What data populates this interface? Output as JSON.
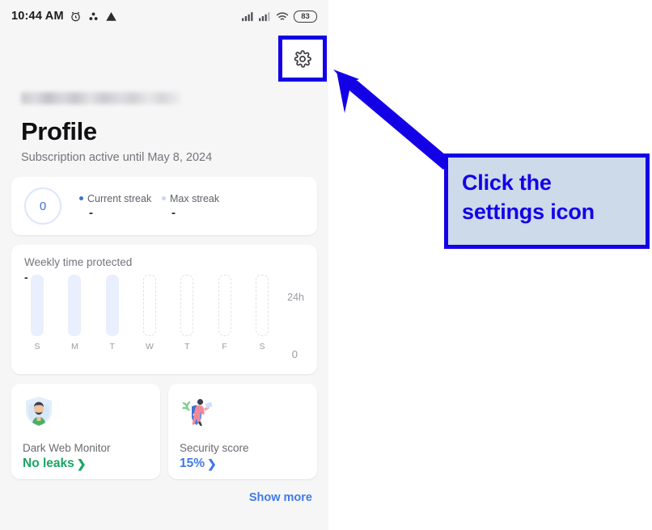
{
  "statusbar": {
    "time": "10:44 AM",
    "icons": [
      "alarm-clock-icon",
      "dots-cluster-icon",
      "warning-triangle-icon"
    ],
    "signal_icons": [
      "signal-bars-icon",
      "signal-bars-icon",
      "wifi-icon"
    ],
    "battery_level": "83"
  },
  "header": {
    "settings_icon": "gear-icon",
    "account_email_redacted": "",
    "title": "Profile",
    "subtitle": "Subscription active until May 8, 2024"
  },
  "streak_card": {
    "ring_value": "0",
    "legend": [
      {
        "label": "Current streak",
        "value": "-",
        "color": "#3f6fd8"
      },
      {
        "label": "Max streak",
        "value": "-",
        "color": "#c8d6f2"
      }
    ]
  },
  "chart_data": {
    "type": "bar",
    "title": "Weekly time protected",
    "value_label": "-",
    "categories": [
      "S",
      "M",
      "T",
      "W",
      "T",
      "F",
      "S"
    ],
    "values": [
      24,
      24,
      24,
      0,
      0,
      0,
      0
    ],
    "states": [
      "filled",
      "filled",
      "filled",
      "empty",
      "empty",
      "empty",
      "empty"
    ],
    "ylim": [
      0,
      24
    ],
    "ytick_top": "24h",
    "ytick_bottom": "0",
    "xlabel": "",
    "ylabel": "",
    "grid": false,
    "legend_position": "none",
    "bar_fill_color": "#e9effc",
    "empty_bar_border_color": "#e2e2e6"
  },
  "mini_cards": [
    {
      "icon": "shield-person-icon",
      "title": "Dark Web Monitor",
      "link_text": "No leaks",
      "chevron": "❯",
      "link_color": "#19a562"
    },
    {
      "icon": "shield-chart-person-icon",
      "title": "Security score",
      "link_text": "15%",
      "chevron": "❯",
      "link_color": "#3f79e8"
    }
  ],
  "footer": {
    "show_more": "Show more"
  },
  "annotation": {
    "line1": "Click the",
    "line2": "settings icon",
    "border_color": "#1400e6",
    "fill_color": "#ccdaea",
    "text_color": "#1400e6",
    "arrow_icon": "arrow-up-left-icon"
  }
}
